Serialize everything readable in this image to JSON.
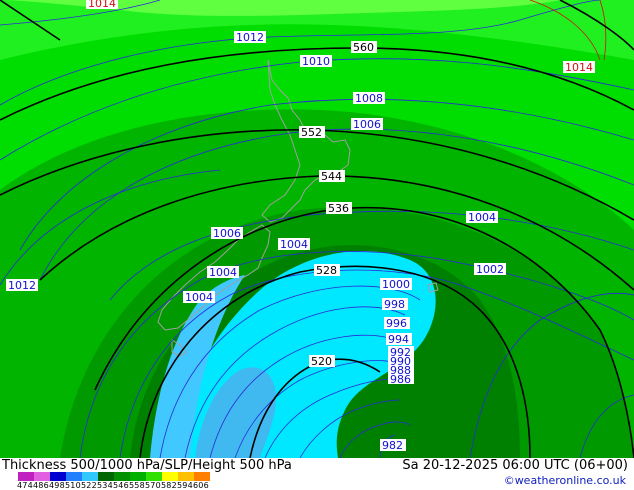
{
  "title": "Thickness 500/1000 hPa/SLP/Height 500 hPa",
  "datetime": "Sa 20-12-2025 06:00 UTC (06+00)",
  "credit": "©weatheronline.co.uk",
  "legend": {
    "labels": [
      "474",
      "486",
      "498",
      "510",
      "522",
      "534",
      "546",
      "558",
      "570",
      "582",
      "594",
      "606"
    ],
    "colors": [
      "#c020c0",
      "#e060e0",
      "#0000d0",
      "#2080ff",
      "#30c8ff",
      "#006600",
      "#009000",
      "#00b000",
      "#30e000",
      "#ffff00",
      "#ffc000",
      "#ff8000"
    ]
  },
  "isobars": {
    "labels": [
      "1014",
      "1012",
      "1010",
      "1008",
      "1006",
      "1004",
      "1014",
      "1006",
      "1004",
      "1012",
      "1004",
      "1004",
      "1002",
      "1000",
      "998",
      "996",
      "994",
      "992",
      "990",
      "988",
      "986",
      "982",
      "1004"
    ]
  },
  "heights": [
    "560",
    "552",
    "544",
    "536",
    "528",
    "520"
  ],
  "colors": {
    "isobar": "#1a1ad0",
    "height": "#000000",
    "thickness_red": "#d01010"
  }
}
